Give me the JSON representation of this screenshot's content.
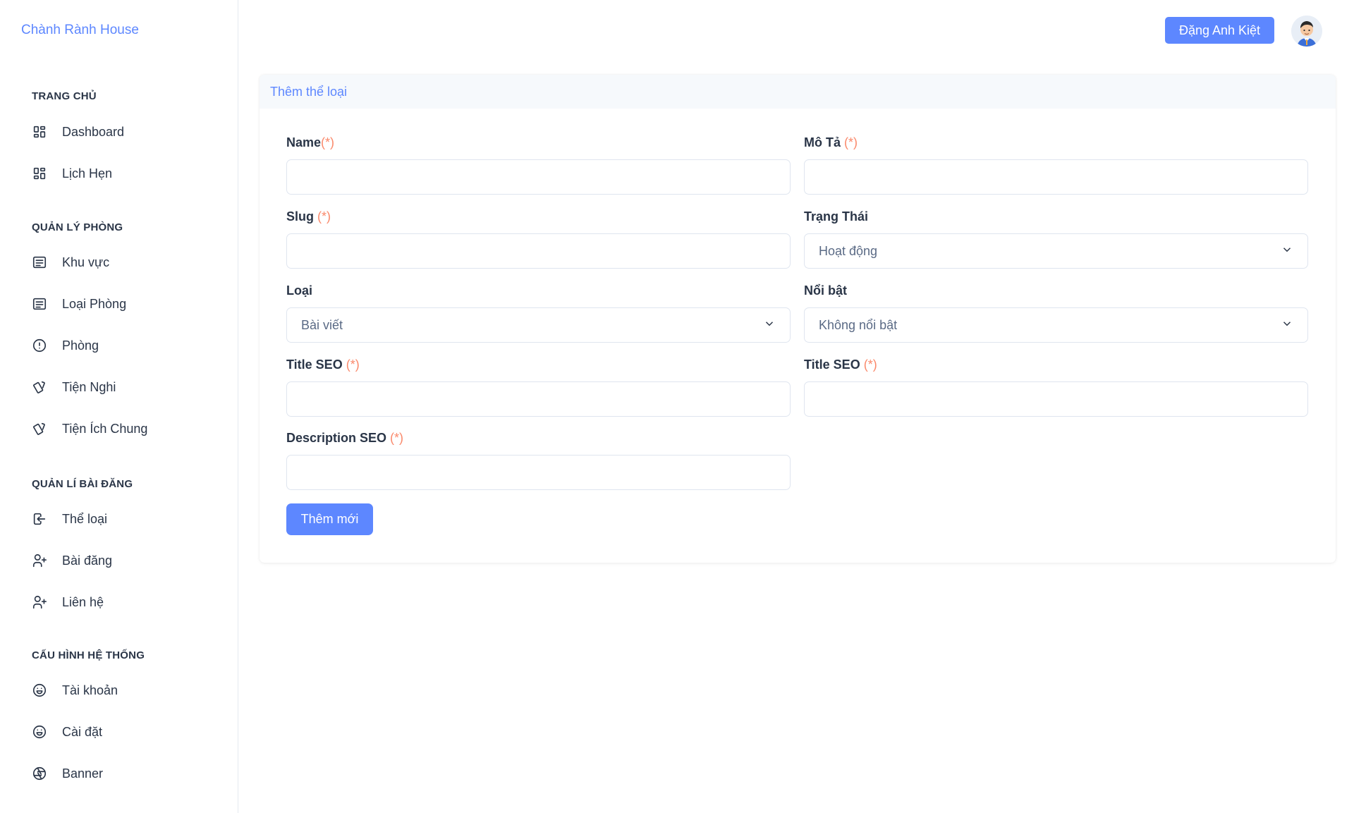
{
  "brand": "Chành Rành House",
  "user": {
    "name": "Đặng Anh Kiệt"
  },
  "sidebar": {
    "sections": [
      {
        "title": "TRANG CHỦ",
        "items": [
          {
            "label": "Dashboard",
            "icon": "dashboard-icon"
          },
          {
            "label": "Lịch Hẹn",
            "icon": "dashboard-icon"
          }
        ]
      },
      {
        "title": "QUẢN LÝ PHÒNG",
        "items": [
          {
            "label": "Khu vực",
            "icon": "list-icon"
          },
          {
            "label": "Loại Phòng",
            "icon": "list-icon"
          },
          {
            "label": "Phòng",
            "icon": "alert-circle-icon"
          },
          {
            "label": "Tiện Nghi",
            "icon": "cards-icon"
          },
          {
            "label": "Tiện Ích Chung",
            "icon": "cards-icon"
          }
        ]
      },
      {
        "title": "QUẢN LÍ BÀI ĐĂNG",
        "items": [
          {
            "label": "Thể loại",
            "icon": "login-icon"
          },
          {
            "label": "Bài đăng",
            "icon": "user-plus-icon"
          },
          {
            "label": "Liên hệ",
            "icon": "user-plus-icon"
          }
        ]
      },
      {
        "title": "CẤU HÌNH HỆ THỐNG",
        "items": [
          {
            "label": "Tài khoản",
            "icon": "mood-icon"
          },
          {
            "label": "Cài đặt",
            "icon": "mood-icon"
          },
          {
            "label": "Banner",
            "icon": "aperture-icon"
          }
        ]
      }
    ]
  },
  "card": {
    "title": "Thêm thể loại",
    "fields": {
      "name": {
        "label": "Name",
        "required": "(*)",
        "value": ""
      },
      "mota": {
        "label": "Mô Tả",
        "required": "(*)",
        "value": ""
      },
      "slug": {
        "label": "Slug",
        "required": "(*)",
        "value": ""
      },
      "trangthai": {
        "label": "Trạng Thái",
        "selected": "Hoạt động"
      },
      "loai": {
        "label": "Loại",
        "selected": "Bài viết"
      },
      "noibat": {
        "label": "Nổi bật",
        "selected": "Không nổi bật"
      },
      "title_seo_1": {
        "label": "Title SEO",
        "required": "(*)",
        "value": ""
      },
      "title_seo_2": {
        "label": "Title SEO",
        "required": "(*)",
        "value": ""
      },
      "description_seo": {
        "label": "Description SEO",
        "required": "(*)",
        "value": ""
      }
    },
    "submit_label": "Thêm mới"
  },
  "colors": {
    "accent": "#5d87ff",
    "required": "#fa896b",
    "text": "#2a3547"
  }
}
